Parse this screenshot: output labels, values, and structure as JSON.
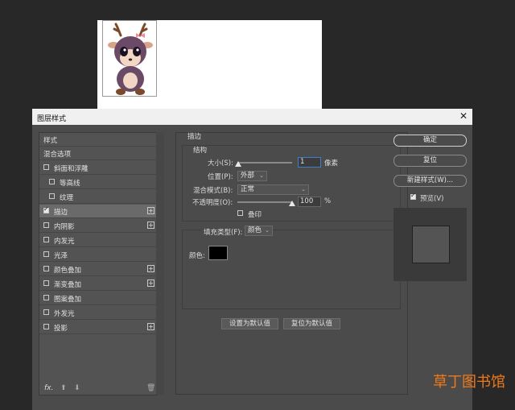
{
  "dialog": {
    "title": "图层样式"
  },
  "left_panel": {
    "items": [
      {
        "label": "样式",
        "checkbox": false,
        "checked": false,
        "plus": false,
        "selected": false
      },
      {
        "label": "混合选项",
        "checkbox": false,
        "checked": false,
        "plus": false,
        "selected": false
      },
      {
        "label": "斜面和浮雕",
        "checkbox": true,
        "checked": false,
        "plus": false,
        "selected": false
      },
      {
        "label": "等高线",
        "checkbox": true,
        "checked": false,
        "plus": false,
        "selected": false,
        "indent": true
      },
      {
        "label": "纹理",
        "checkbox": true,
        "checked": false,
        "plus": false,
        "selected": false,
        "indent": true
      },
      {
        "label": "描边",
        "checkbox": true,
        "checked": true,
        "plus": true,
        "selected": true
      },
      {
        "label": "内阴影",
        "checkbox": true,
        "checked": false,
        "plus": true,
        "selected": false
      },
      {
        "label": "内发光",
        "checkbox": true,
        "checked": false,
        "plus": false,
        "selected": false
      },
      {
        "label": "光泽",
        "checkbox": true,
        "checked": false,
        "plus": false,
        "selected": false
      },
      {
        "label": "颜色叠加",
        "checkbox": true,
        "checked": false,
        "plus": true,
        "selected": false
      },
      {
        "label": "渐变叠加",
        "checkbox": true,
        "checked": false,
        "plus": true,
        "selected": false
      },
      {
        "label": "图案叠加",
        "checkbox": true,
        "checked": false,
        "plus": false,
        "selected": false
      },
      {
        "label": "外发光",
        "checkbox": true,
        "checked": false,
        "plus": false,
        "selected": false
      },
      {
        "label": "投影",
        "checkbox": true,
        "checked": false,
        "plus": true,
        "selected": false
      }
    ],
    "footer": {
      "fx": "fx.",
      "up": "⬆",
      "down": "⬇",
      "trash": "🗑"
    }
  },
  "stroke": {
    "section_title": "描边",
    "structure_title": "结构",
    "size_label": "大小(S):",
    "size_value": "1",
    "size_unit": "像素",
    "position_label": "位置(P):",
    "position_value": "外部",
    "blend_label": "混合模式(B):",
    "blend_value": "正常",
    "opacity_label": "不透明度(O):",
    "opacity_value": "100",
    "opacity_unit": "%",
    "overprint_label": "叠印",
    "fill_type_label": "填充类型(F):",
    "fill_type_value": "颜色",
    "color_label": "颜色:",
    "color_value": "#000000",
    "default_btn": "设置为默认值",
    "reset_btn": "复位为默认值"
  },
  "right": {
    "ok": "确定",
    "reset": "复位",
    "new_style": "新建样式(W)...",
    "preview_label": "预览(V)",
    "preview_checked": true
  },
  "watermark": "草丁图书馆"
}
